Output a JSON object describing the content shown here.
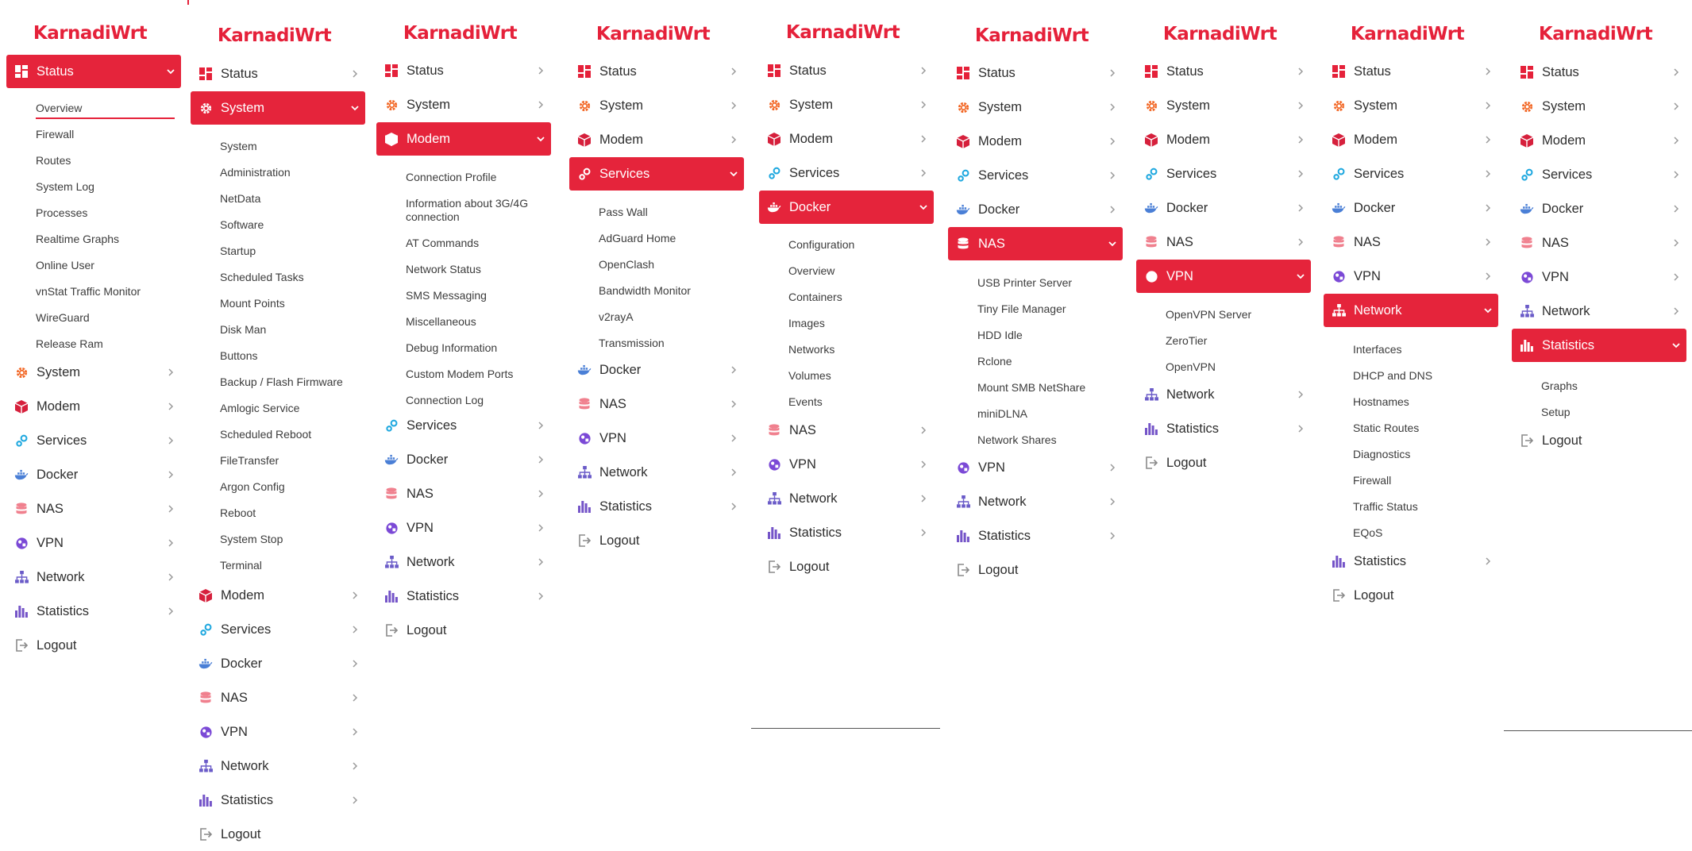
{
  "app": {
    "brand": "KarnadiWrt",
    "colors": {
      "accent": "#e5243b",
      "text": "#2d2d2d",
      "muted": "#888888"
    }
  },
  "labels": {
    "status": "Status",
    "system": "System",
    "modem": "Modem",
    "services": "Services",
    "docker": "Docker",
    "nas": "NAS",
    "vpn": "VPN",
    "network": "Network",
    "statistics": "Statistics",
    "logout": "Logout"
  },
  "submenus": {
    "status": [
      "Overview",
      "Firewall",
      "Routes",
      "System Log",
      "Processes",
      "Realtime Graphs",
      "Online User",
      "vnStat Traffic Monitor",
      "WireGuard",
      "Release Ram"
    ],
    "system": [
      "System",
      "Administration",
      "NetData",
      "Software",
      "Startup",
      "Scheduled Tasks",
      "Mount Points",
      "Disk Man",
      "Buttons",
      "Backup / Flash Firmware",
      "Amlogic Service",
      "Scheduled Reboot",
      "FileTransfer",
      "Argon Config",
      "Reboot",
      "System Stop",
      "Terminal"
    ],
    "modem": [
      "Connection Profile",
      "Information about 3G/4G connection",
      "AT Commands",
      "Network Status",
      "SMS Messaging",
      "Miscellaneous",
      "Debug Information",
      "Custom Modem Ports",
      "Connection Log"
    ],
    "services": [
      "Pass Wall",
      "AdGuard Home",
      "OpenClash",
      "Bandwidth Monitor",
      "v2rayA",
      "Transmission"
    ],
    "docker": [
      "Configuration",
      "Overview",
      "Containers",
      "Images",
      "Networks",
      "Volumes",
      "Events"
    ],
    "nas": [
      "USB Printer Server",
      "Tiny File Manager",
      "HDD Idle",
      "Rclone",
      "Mount SMB NetShare",
      "miniDLNA",
      "Network Shares"
    ],
    "vpn": [
      "OpenVPN Server",
      "ZeroTier",
      "OpenVPN"
    ],
    "network": [
      "Interfaces",
      "DHCP and DNS",
      "Hostnames",
      "Static Routes",
      "Diagnostics",
      "Firewall",
      "Traffic Status",
      "EQoS"
    ],
    "statistics": [
      "Graphs",
      "Setup"
    ]
  }
}
